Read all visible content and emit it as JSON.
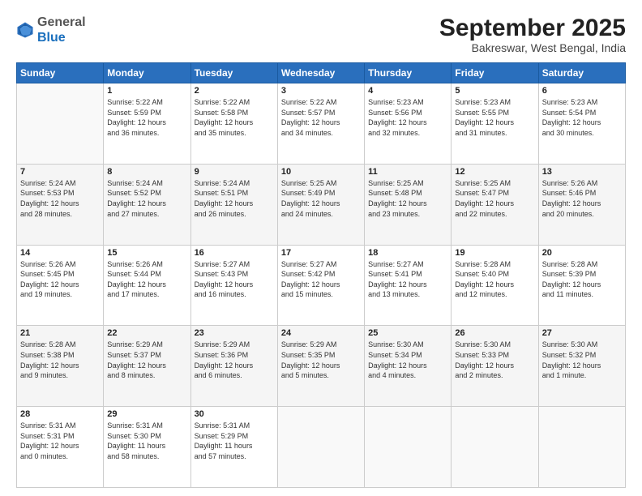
{
  "header": {
    "logo": {
      "general": "General",
      "blue": "Blue"
    },
    "title": "September 2025",
    "subtitle": "Bakreswar, West Bengal, India"
  },
  "days_of_week": [
    "Sunday",
    "Monday",
    "Tuesday",
    "Wednesday",
    "Thursday",
    "Friday",
    "Saturday"
  ],
  "weeks": [
    [
      {
        "day": "",
        "info": ""
      },
      {
        "day": "1",
        "info": "Sunrise: 5:22 AM\nSunset: 5:59 PM\nDaylight: 12 hours\nand 36 minutes."
      },
      {
        "day": "2",
        "info": "Sunrise: 5:22 AM\nSunset: 5:58 PM\nDaylight: 12 hours\nand 35 minutes."
      },
      {
        "day": "3",
        "info": "Sunrise: 5:22 AM\nSunset: 5:57 PM\nDaylight: 12 hours\nand 34 minutes."
      },
      {
        "day": "4",
        "info": "Sunrise: 5:23 AM\nSunset: 5:56 PM\nDaylight: 12 hours\nand 32 minutes."
      },
      {
        "day": "5",
        "info": "Sunrise: 5:23 AM\nSunset: 5:55 PM\nDaylight: 12 hours\nand 31 minutes."
      },
      {
        "day": "6",
        "info": "Sunrise: 5:23 AM\nSunset: 5:54 PM\nDaylight: 12 hours\nand 30 minutes."
      }
    ],
    [
      {
        "day": "7",
        "info": "Sunrise: 5:24 AM\nSunset: 5:53 PM\nDaylight: 12 hours\nand 28 minutes."
      },
      {
        "day": "8",
        "info": "Sunrise: 5:24 AM\nSunset: 5:52 PM\nDaylight: 12 hours\nand 27 minutes."
      },
      {
        "day": "9",
        "info": "Sunrise: 5:24 AM\nSunset: 5:51 PM\nDaylight: 12 hours\nand 26 minutes."
      },
      {
        "day": "10",
        "info": "Sunrise: 5:25 AM\nSunset: 5:49 PM\nDaylight: 12 hours\nand 24 minutes."
      },
      {
        "day": "11",
        "info": "Sunrise: 5:25 AM\nSunset: 5:48 PM\nDaylight: 12 hours\nand 23 minutes."
      },
      {
        "day": "12",
        "info": "Sunrise: 5:25 AM\nSunset: 5:47 PM\nDaylight: 12 hours\nand 22 minutes."
      },
      {
        "day": "13",
        "info": "Sunrise: 5:26 AM\nSunset: 5:46 PM\nDaylight: 12 hours\nand 20 minutes."
      }
    ],
    [
      {
        "day": "14",
        "info": "Sunrise: 5:26 AM\nSunset: 5:45 PM\nDaylight: 12 hours\nand 19 minutes."
      },
      {
        "day": "15",
        "info": "Sunrise: 5:26 AM\nSunset: 5:44 PM\nDaylight: 12 hours\nand 17 minutes."
      },
      {
        "day": "16",
        "info": "Sunrise: 5:27 AM\nSunset: 5:43 PM\nDaylight: 12 hours\nand 16 minutes."
      },
      {
        "day": "17",
        "info": "Sunrise: 5:27 AM\nSunset: 5:42 PM\nDaylight: 12 hours\nand 15 minutes."
      },
      {
        "day": "18",
        "info": "Sunrise: 5:27 AM\nSunset: 5:41 PM\nDaylight: 12 hours\nand 13 minutes."
      },
      {
        "day": "19",
        "info": "Sunrise: 5:28 AM\nSunset: 5:40 PM\nDaylight: 12 hours\nand 12 minutes."
      },
      {
        "day": "20",
        "info": "Sunrise: 5:28 AM\nSunset: 5:39 PM\nDaylight: 12 hours\nand 11 minutes."
      }
    ],
    [
      {
        "day": "21",
        "info": "Sunrise: 5:28 AM\nSunset: 5:38 PM\nDaylight: 12 hours\nand 9 minutes."
      },
      {
        "day": "22",
        "info": "Sunrise: 5:29 AM\nSunset: 5:37 PM\nDaylight: 12 hours\nand 8 minutes."
      },
      {
        "day": "23",
        "info": "Sunrise: 5:29 AM\nSunset: 5:36 PM\nDaylight: 12 hours\nand 6 minutes."
      },
      {
        "day": "24",
        "info": "Sunrise: 5:29 AM\nSunset: 5:35 PM\nDaylight: 12 hours\nand 5 minutes."
      },
      {
        "day": "25",
        "info": "Sunrise: 5:30 AM\nSunset: 5:34 PM\nDaylight: 12 hours\nand 4 minutes."
      },
      {
        "day": "26",
        "info": "Sunrise: 5:30 AM\nSunset: 5:33 PM\nDaylight: 12 hours\nand 2 minutes."
      },
      {
        "day": "27",
        "info": "Sunrise: 5:30 AM\nSunset: 5:32 PM\nDaylight: 12 hours\nand 1 minute."
      }
    ],
    [
      {
        "day": "28",
        "info": "Sunrise: 5:31 AM\nSunset: 5:31 PM\nDaylight: 12 hours\nand 0 minutes."
      },
      {
        "day": "29",
        "info": "Sunrise: 5:31 AM\nSunset: 5:30 PM\nDaylight: 11 hours\nand 58 minutes."
      },
      {
        "day": "30",
        "info": "Sunrise: 5:31 AM\nSunset: 5:29 PM\nDaylight: 11 hours\nand 57 minutes."
      },
      {
        "day": "",
        "info": ""
      },
      {
        "day": "",
        "info": ""
      },
      {
        "day": "",
        "info": ""
      },
      {
        "day": "",
        "info": ""
      }
    ]
  ]
}
